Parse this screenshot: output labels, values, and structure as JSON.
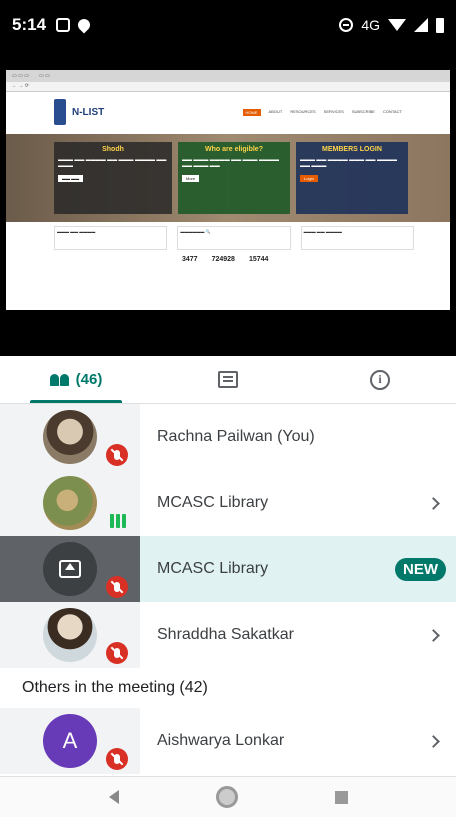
{
  "status_bar": {
    "time": "5:14",
    "network": "4G"
  },
  "shared_screen": {
    "site_title": "N-LIST",
    "nav_items": [
      "HOME",
      "ABOUT",
      "RESOURCES",
      "SERVICES",
      "SUBSCRIBE",
      "CONTACT"
    ],
    "card_a_text": "Shodh",
    "card_b_title": "Who are eligible?",
    "card_b_button": "More",
    "card_c_title": "MEMBERS LOGIN",
    "card_c_button": "Login",
    "stats": [
      "3477",
      "724928",
      "15744"
    ]
  },
  "tabs": {
    "people_count": "(46)"
  },
  "participants": [
    {
      "name": "Rachna Pailwan (You)",
      "muted": true
    },
    {
      "name": "MCASC Library",
      "speaking": true
    },
    {
      "name": "MCASC Library",
      "presenting": true,
      "badge": "NEW"
    },
    {
      "name": "Shraddha Sakatkar",
      "muted": true
    }
  ],
  "others_section": {
    "label": "Others in the meeting (42)"
  },
  "others": [
    {
      "initial": "A",
      "name": "Aishwarya Lonkar",
      "avatar_color": "#673ab7"
    }
  ],
  "colors": {
    "accent": "#00796b",
    "mute_red": "#d93025",
    "presenting_bg": "#e0f2f1"
  }
}
